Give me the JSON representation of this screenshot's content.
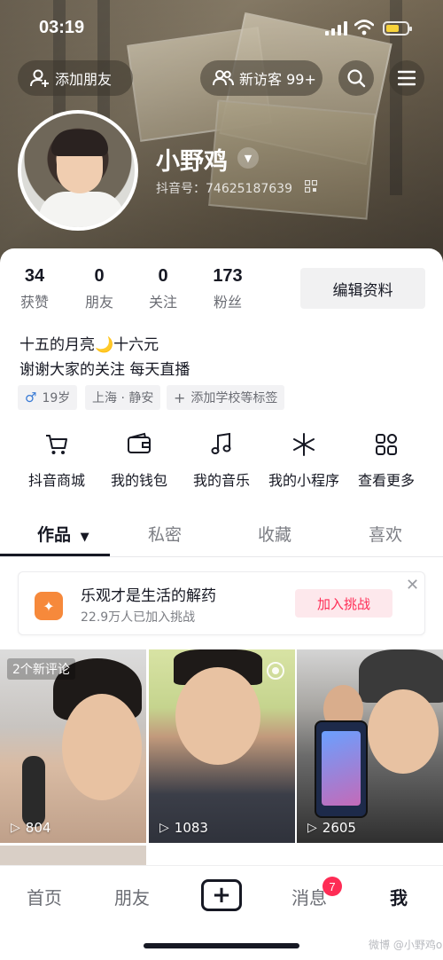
{
  "status": {
    "time": "03:19"
  },
  "top": {
    "add_friend": "添加朋友",
    "visitors": "新访客 99+"
  },
  "profile": {
    "nickname": "小野鸡",
    "douyin_id": "抖音号：74625187639"
  },
  "stats": [
    {
      "num": "34",
      "label": "获赞"
    },
    {
      "num": "0",
      "label": "朋友"
    },
    {
      "num": "0",
      "label": "关注"
    },
    {
      "num": "173",
      "label": "粉丝"
    }
  ],
  "edit_profile": "编辑资料",
  "bio": {
    "line1": "十五的月亮🌙十六元",
    "line2": "谢谢大家的关注 每天直播"
  },
  "tags": {
    "age": "19岁",
    "location": "上海 · 静安",
    "add_school": "添加学校等标签"
  },
  "services": [
    {
      "label": "抖音商城",
      "icon": "cart-icon"
    },
    {
      "label": "我的钱包",
      "icon": "wallet-icon"
    },
    {
      "label": "我的音乐",
      "icon": "music-note-icon"
    },
    {
      "label": "我的小程序",
      "icon": "mini-program-icon"
    },
    {
      "label": "查看更多",
      "icon": "grid-more-icon"
    }
  ],
  "tabs": [
    "作品",
    "私密",
    "收藏",
    "喜欢"
  ],
  "challenge": {
    "title": "乐观才是生活的解药",
    "subtitle": "22.9万人已加入挑战",
    "join": "加入挑战"
  },
  "videos": [
    {
      "plays": "804",
      "badge": "2个新评论"
    },
    {
      "plays": "1083"
    },
    {
      "plays": "2605"
    }
  ],
  "nav": {
    "home": "首页",
    "friends": "朋友",
    "messages": "消息",
    "me": "我",
    "message_badge": "7"
  },
  "watermark": "微博 @小野鸡o",
  "colors": {
    "accent": "#fe2c55",
    "text": "#161823",
    "muted": "#6b6d74",
    "challenge_icon": "#f6893b"
  }
}
